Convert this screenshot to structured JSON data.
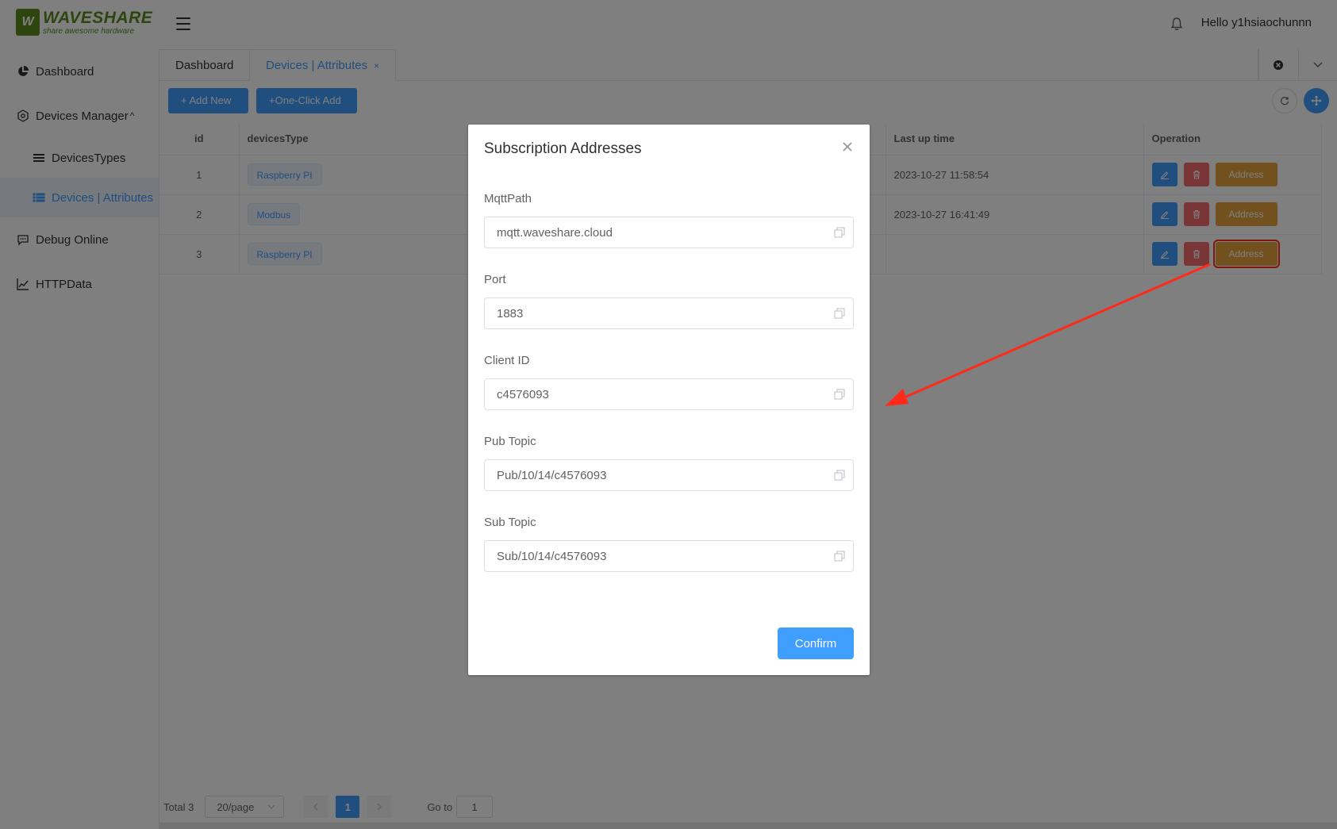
{
  "logo": {
    "mark": "W",
    "name": "WAVESHARE",
    "tagline": "share awesome hardware"
  },
  "header": {
    "greeting": "Hello y1hsiaochunnn"
  },
  "sidebar": {
    "items": [
      {
        "label": "Dashboard"
      },
      {
        "label": "Devices Manager"
      },
      {
        "label": "DevicesTypes"
      },
      {
        "label": "Devices | Attributes"
      },
      {
        "label": "Debug Online"
      },
      {
        "label": "HTTPData"
      }
    ]
  },
  "tabs": [
    {
      "label": "Dashboard"
    },
    {
      "label": "Devices | Attributes",
      "close": "×"
    }
  ],
  "toolbar": {
    "add_new": "+ Add New",
    "one_click_add": "+One-Click Add"
  },
  "table": {
    "headers": {
      "id": "id",
      "type": "devicesType",
      "last": "Last up time",
      "op": "Operation"
    },
    "rows": [
      {
        "id": "1",
        "type": "Raspberry PI",
        "last": "2023-10-27 11:58:54"
      },
      {
        "id": "2",
        "type": "Modbus",
        "last": "2023-10-27 16:41:49"
      },
      {
        "id": "3",
        "type": "Raspberry PI",
        "last": ""
      }
    ],
    "address_label": "Address"
  },
  "pager": {
    "total": "Total 3",
    "size": "20/page",
    "page": "1",
    "goto_label": "Go to",
    "goto_value": "1"
  },
  "dialog": {
    "title": "Subscription Addresses",
    "fields": [
      {
        "label": "MqttPath",
        "value": "mqtt.waveshare.cloud"
      },
      {
        "label": "Port",
        "value": "1883"
      },
      {
        "label": "Client ID",
        "value": "c4576093"
      },
      {
        "label": "Pub Topic",
        "value": "Pub/10/14/c4576093"
      },
      {
        "label": "Sub Topic",
        "value": "Sub/10/14/c4576093"
      }
    ],
    "confirm": "Confirm"
  },
  "colors": {
    "primary": "#409eff",
    "danger": "#f56c6c",
    "warning": "#e6a23c",
    "annotation": "#ff2a1a",
    "brand": "#5c8a1f"
  }
}
